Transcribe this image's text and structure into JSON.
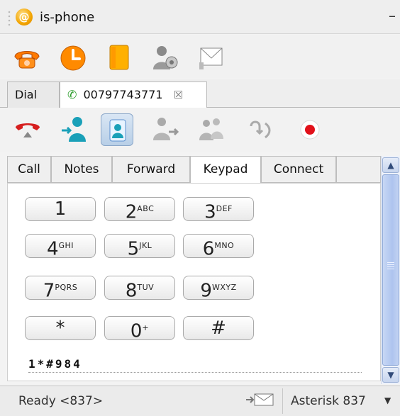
{
  "app": {
    "title": "is-phone",
    "minimize": "–"
  },
  "call_tabs": {
    "dial": "Dial",
    "active_number": "00797743771",
    "close_glyph": "☒"
  },
  "sub_tabs": [
    "Call",
    "Notes",
    "Forward",
    "Keypad",
    "Connect"
  ],
  "keypad": {
    "keys": [
      {
        "digit": "1",
        "letters": ""
      },
      {
        "digit": "2",
        "letters": "ABC"
      },
      {
        "digit": "3",
        "letters": "DEF"
      },
      {
        "digit": "4",
        "letters": "GHI"
      },
      {
        "digit": "5",
        "letters": "JKL"
      },
      {
        "digit": "6",
        "letters": "MNO"
      },
      {
        "digit": "7",
        "letters": "PQRS"
      },
      {
        "digit": "8",
        "letters": "TUV"
      },
      {
        "digit": "9",
        "letters": "WXYZ"
      },
      {
        "digit": "*",
        "letters": ""
      },
      {
        "digit": "0",
        "letters": "+"
      },
      {
        "digit": "#",
        "letters": ""
      }
    ],
    "entered": "1*#984"
  },
  "status": {
    "text": "Ready <837>",
    "account": "Asterisk 837"
  },
  "colors": {
    "accent_blue": "#3b6fb6",
    "hangup_red": "#d61f1f",
    "record_red": "#e1111a"
  },
  "icons": {
    "toolbar": [
      "phone-icon",
      "history-clock-icon",
      "addressbook-icon",
      "settings-user-icon",
      "message-icon"
    ],
    "controls": [
      "hangup-icon",
      "transfer-in-icon",
      "contact-card-icon",
      "transfer-user-icon",
      "conference-icon",
      "redirect-icon",
      "record-icon"
    ]
  }
}
